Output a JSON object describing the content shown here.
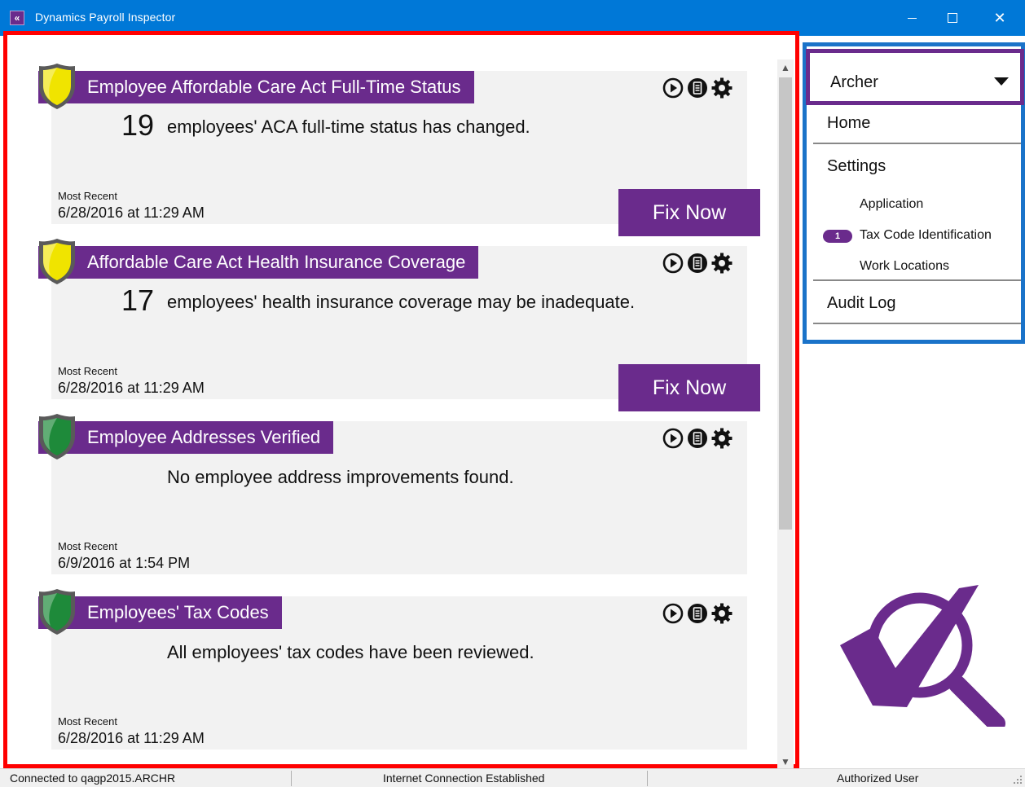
{
  "window": {
    "title": "Dynamics Payroll Inspector",
    "app_icon_glyph": "«",
    "close_glyph": "✕"
  },
  "cards": [
    {
      "title": "Employee Affordable Care Act Full-Time Status",
      "shield_color": "#f0e400",
      "count": "19",
      "message": "employees' ACA full-time status has changed.",
      "recent_label": "Most Recent",
      "recent_date": "6/28/2016 at 11:29 AM",
      "fix_label": "Fix Now"
    },
    {
      "title": "Affordable Care Act Health Insurance Coverage",
      "shield_color": "#f0e400",
      "count": "17",
      "message": "employees' health insurance coverage may be inadequate.",
      "recent_label": "Most Recent",
      "recent_date": "6/28/2016 at 11:29 AM",
      "fix_label": "Fix Now"
    },
    {
      "title": "Employee Addresses Verified",
      "shield_color": "#1e8a3a",
      "count": "",
      "message": "No employee address improvements found.",
      "recent_label": "Most Recent",
      "recent_date": "6/9/2016 at 1:54 PM",
      "fix_label": ""
    },
    {
      "title": "Employees' Tax Codes",
      "shield_color": "#1e8a3a",
      "count": "",
      "message": "All employees' tax codes have been reviewed.",
      "recent_label": "Most Recent",
      "recent_date": "6/28/2016 at 11:29 AM",
      "fix_label": ""
    }
  ],
  "nav": {
    "user": "Archer",
    "items": [
      {
        "label": "Home"
      },
      {
        "label": "Settings"
      },
      {
        "label": "Audit Log"
      }
    ],
    "settings_sub": [
      {
        "label": "Application",
        "badge": ""
      },
      {
        "label": "Tax Code Identification",
        "badge": "1"
      },
      {
        "label": "Work Locations",
        "badge": ""
      }
    ]
  },
  "status_bar": {
    "connection": "Connected to qagp2015.ARCHR",
    "internet": "Internet Connection Established",
    "user_status": "Authorized User"
  },
  "colors": {
    "accent": "#6a2b8c",
    "titlebar": "#0078d7",
    "highlight_red": "#ff0000",
    "highlight_blue": "#1a73c9"
  }
}
